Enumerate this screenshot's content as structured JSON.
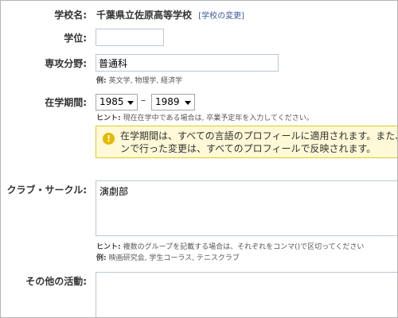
{
  "school": {
    "label": "学校名:",
    "value": "千葉県立佐原高等学校",
    "link_open": "[",
    "change_link": "学校の変更",
    "link_close": "]"
  },
  "degree": {
    "label": "学位:",
    "value": ""
  },
  "major": {
    "label": "専攻分野:",
    "value": "普通科",
    "example_prefix": "例:",
    "example": "英文学, 物理学, 経済学"
  },
  "period": {
    "label": "在学期間:",
    "from_year": "1985",
    "separator": "–",
    "to_year": "1989",
    "hint_prefix": "ヒント:",
    "hint": "現在在学中である場合は, 卒業予定年を入力してください。"
  },
  "notice": {
    "icon": "!",
    "line1": "在学期間は、すべての言語のプロフィールに適用されます。また、",
    "line2": "ンで行った変更は、すべてのプロフィールで反映されます。"
  },
  "clubs": {
    "label": "クラブ・サークル:",
    "value": "演劇部",
    "hint_prefix": "ヒント:",
    "hint": "複数のグループを記載する場合は、それぞれをコンマ()で区切ってください",
    "example_prefix": "例:",
    "example": "映画研究会, 学生コーラス, テニスクラブ"
  },
  "other": {
    "label": "その他の活動:",
    "value": ""
  },
  "colors": {
    "link": "#3b5998",
    "notice_bg": "#fff9d7",
    "notice_border": "#e2c822",
    "input_border": "#bdc7d8"
  }
}
